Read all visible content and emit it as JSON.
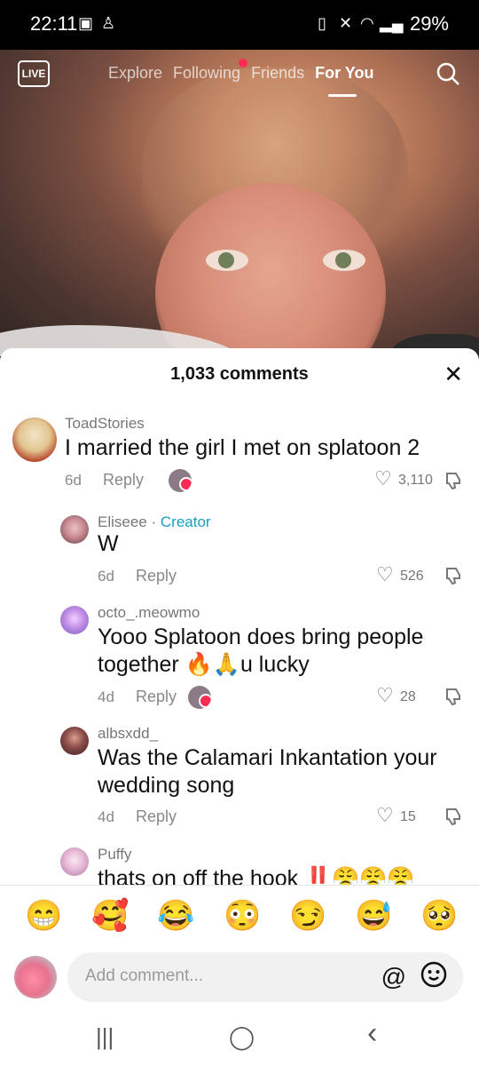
{
  "status": {
    "time": "22:11",
    "battery": "29%"
  },
  "topnav": {
    "live_label": "LIVE",
    "tabs": [
      "Explore",
      "Following",
      "Friends",
      "For You"
    ],
    "active_tab": "For You"
  },
  "sheet": {
    "title": "1,033 comments"
  },
  "comments": [
    {
      "username": "ToadStories",
      "text": "I married the girl I met on splatoon 2",
      "age": "6d",
      "reply_label": "Reply",
      "likes": "3,110"
    },
    {
      "username": "Eliseee",
      "badge": "Creator",
      "text": "W",
      "age": "6d",
      "reply_label": "Reply",
      "likes": "526"
    },
    {
      "username": "octo_.meowmo",
      "text_line1": "Yooo Splatoon does bring people",
      "text_line2": "together 🔥🙏u lucky",
      "age": "4d",
      "reply_label": "Reply",
      "likes": "28"
    },
    {
      "username": "albsxdd_",
      "text_line1": "Was the Calamari Inkantation your",
      "text_line2": "wedding song",
      "age": "4d",
      "reply_label": "Reply",
      "likes": "15"
    },
    {
      "username": "Puffy",
      "text": "thats on off the hook ‼️😤😤😤"
    }
  ],
  "emoji_bar": [
    "😁",
    "🥰",
    "😂",
    "😳",
    "😏",
    "😅",
    "🥺"
  ],
  "input": {
    "placeholder": "Add comment...",
    "at_symbol": "@"
  },
  "navbar": {
    "recents": "|||",
    "home": "◯",
    "back": "‹"
  }
}
